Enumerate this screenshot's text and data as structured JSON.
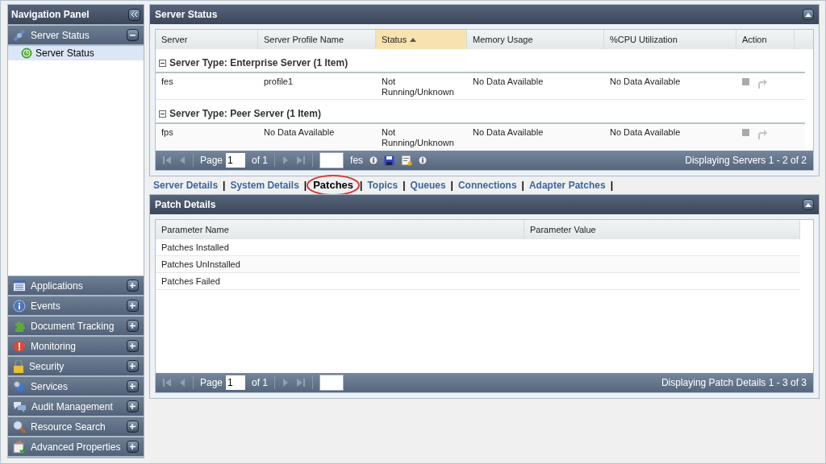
{
  "navigation": {
    "title": "Navigation Panel",
    "sections": [
      {
        "label": "Server Status",
        "expanded": true,
        "children": [
          {
            "label": "Server Status",
            "selected": true
          }
        ]
      },
      {
        "label": "Applications",
        "expanded": false
      },
      {
        "label": "Events",
        "expanded": false
      },
      {
        "label": "Document Tracking",
        "expanded": false
      },
      {
        "label": "Monitoring",
        "expanded": false
      },
      {
        "label": "Security",
        "expanded": false
      },
      {
        "label": "Services",
        "expanded": false
      },
      {
        "label": "Audit Management",
        "expanded": false
      },
      {
        "label": "Resource Search",
        "expanded": false
      },
      {
        "label": "Advanced Properties",
        "expanded": false
      }
    ]
  },
  "server_status": {
    "title": "Server Status",
    "columns": [
      {
        "label": "Server",
        "sorted": false
      },
      {
        "label": "Server Profile Name",
        "sorted": false
      },
      {
        "label": "Status",
        "sorted": true
      },
      {
        "label": "Memory Usage",
        "sorted": false
      },
      {
        "label": "%CPU Utilization",
        "sorted": false
      },
      {
        "label": "Action",
        "sorted": false
      }
    ],
    "groups": [
      {
        "label": "Server Type: Enterprise Server (1 Item)",
        "expanded": true,
        "rows": [
          [
            "fes",
            "profile1",
            "Not Running/Unknown",
            "No Data Available",
            "No Data Available"
          ]
        ]
      },
      {
        "label": "Server Type: Peer Server (1 Item)",
        "expanded": true,
        "rows": [
          [
            "fps",
            "No Data Available",
            "Not Running/Unknown",
            "No Data Available",
            "No Data Available"
          ]
        ]
      }
    ],
    "pager": {
      "page_label": "Page",
      "page": "1",
      "of": "of 1",
      "filter_label": "fes",
      "summary": "Displaying Servers 1 - 2 of 2"
    }
  },
  "tabs": [
    {
      "label": "Server Details",
      "selected": false
    },
    {
      "label": "System Details",
      "selected": false
    },
    {
      "label": "Patches",
      "selected": true
    },
    {
      "label": "Topics",
      "selected": false
    },
    {
      "label": "Queues",
      "selected": false
    },
    {
      "label": "Connections",
      "selected": false
    },
    {
      "label": "Adapter Patches",
      "selected": false
    }
  ],
  "tab_separator": "|",
  "patch_details": {
    "title": "Patch Details",
    "columns": [
      "Parameter Name",
      "Parameter Value"
    ],
    "rows": [
      [
        "Patches Installed"
      ],
      [
        "Patches UnInstalled"
      ],
      [
        "Patches Failed"
      ]
    ],
    "pager": {
      "page_label": "Page",
      "page": "1",
      "of": "of 1",
      "summary": "Displaying Patch Details 1 - 3 of 3"
    }
  }
}
